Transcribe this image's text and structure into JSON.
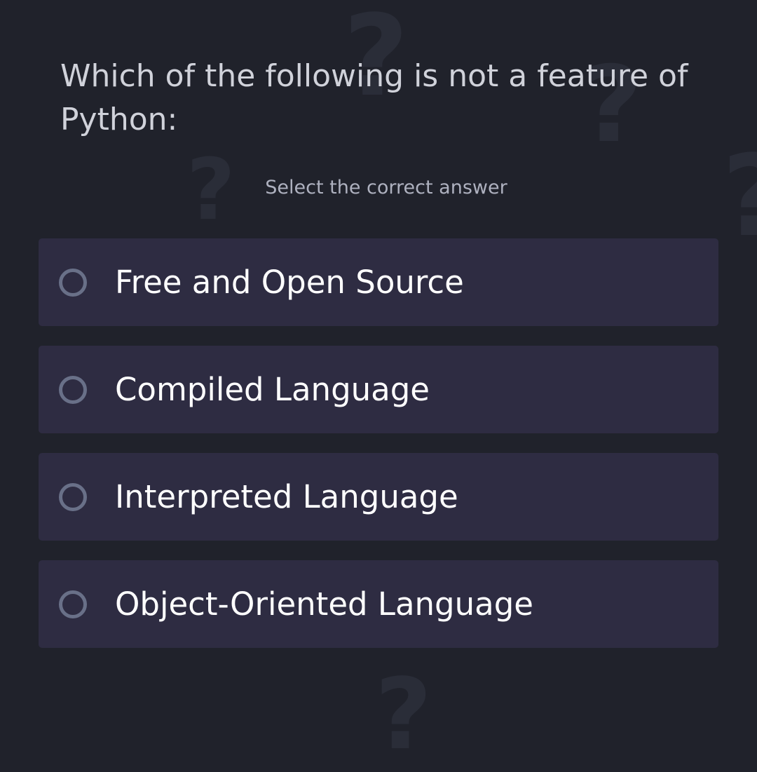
{
  "quiz": {
    "question": "Which of the following is not a feature of Python:",
    "hint": "Select the correct answer",
    "options": [
      {
        "label": "Free and Open Source"
      },
      {
        "label": "Compiled Language"
      },
      {
        "label": "Interpreted Language"
      },
      {
        "label": "Object-Oriented Language"
      }
    ]
  },
  "background": {
    "mark_icon": "question-mark-icon"
  },
  "colors": {
    "background": "#20222b",
    "option_background": "#2e2c42",
    "radio_border": "#697088",
    "question_text": "#d0d2da",
    "hint_text": "#aeb1bf",
    "option_text": "#ffffff"
  }
}
